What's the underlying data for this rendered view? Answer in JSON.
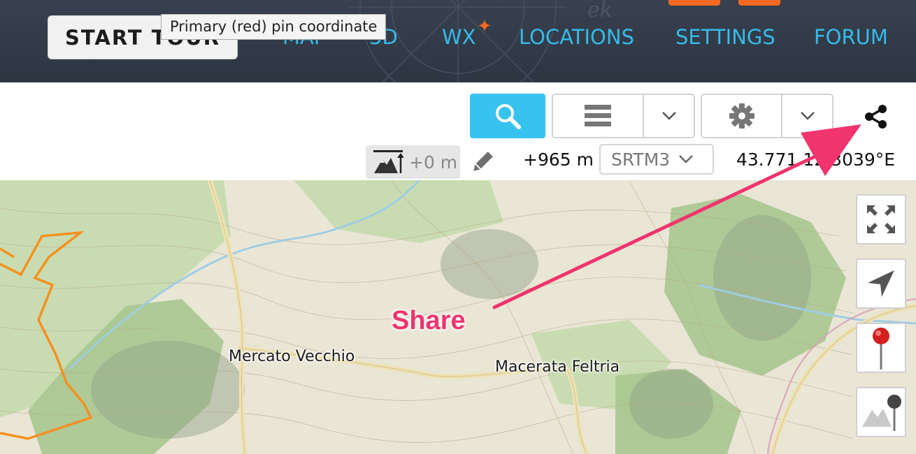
{
  "navbar": {
    "start_tour_label": "START TOUR",
    "links": [
      {
        "label": "MAP"
      },
      {
        "label": "3D"
      },
      {
        "label": "WX"
      },
      {
        "label": "LOCATIONS"
      },
      {
        "label": "SETTINGS"
      },
      {
        "label": "FORUM"
      }
    ],
    "tooltip": "Primary (red) pin coordinate",
    "accent_color": "#35bbe8",
    "highlight_color": "#f26a21"
  },
  "toolbar": {
    "search_icon": "search-icon",
    "layers_icon": "layers-icon",
    "settings_icon": "gear-icon",
    "share_icon": "share-icon",
    "elevation_offset": "+0 m",
    "elevation": "+965 m",
    "dem_source": "SRTM3",
    "coordinate": "43.771   12.3039°E"
  },
  "map": {
    "places": [
      {
        "name": "Mercato Vecchio"
      },
      {
        "name": "Macerata Feltria"
      }
    ],
    "controls": [
      "fullscreen-icon",
      "locate-icon",
      "red-pin-icon",
      "elevation-pin-icon"
    ]
  },
  "annotation": {
    "label": "Share",
    "color": "#f0346e"
  }
}
